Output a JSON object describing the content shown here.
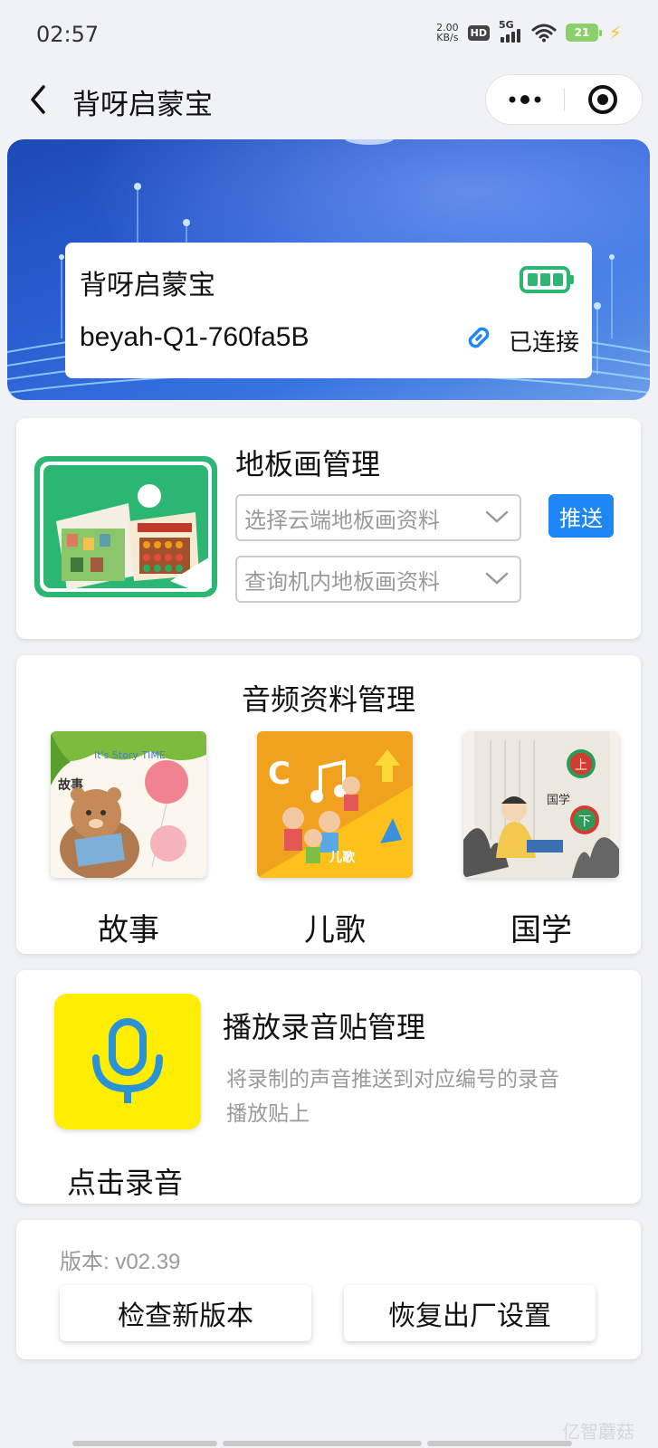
{
  "status_bar": {
    "time": "02:57",
    "net_speed_value": "2.00",
    "net_speed_unit": "KB/s",
    "hd": "HD",
    "signal": "5G",
    "battery": "21",
    "icons": [
      "wifi-icon",
      "battery-icon",
      "charging-bolt-icon"
    ]
  },
  "nav": {
    "title": "背呀启蒙宝",
    "back_icon": "chevron-left-icon",
    "more_icon": "more-dots-icon",
    "close_icon": "target-close-icon"
  },
  "device": {
    "name": "背呀启蒙宝",
    "id": "beyah-Q1-760fa5B",
    "status": "已连接",
    "battery_level": 1.0,
    "battery_color": "#2bb673",
    "link_color": "#1e86f5"
  },
  "floor_mat": {
    "title": "地板画管理",
    "cloud_select_placeholder": "选择云端地板画资料",
    "local_select_placeholder": "查询机内地板画资料",
    "push_label": "推送",
    "accent": "#1e86f5"
  },
  "audio": {
    "title": "音频资料管理",
    "items": [
      {
        "label": "故事",
        "thumb_text": "故事",
        "thumb_banner": "It's Story TIME"
      },
      {
        "label": "儿歌",
        "thumb_text": "儿歌"
      },
      {
        "label": "国学",
        "thumb_text": "国学",
        "thumb_up": "上",
        "thumb_down": "下"
      }
    ]
  },
  "recording": {
    "title": "播放录音贴管理",
    "desc": "将录制的声音推送到对应编号的录音播放贴上",
    "button_label": "点击录音",
    "icon_bg": "#ffee00",
    "icon_color": "#2a93d5"
  },
  "version": {
    "text": "版本: v02.39",
    "check_label": "检查新版本",
    "reset_label": "恢复出厂设置"
  },
  "watermark": "亿智蘑菇"
}
